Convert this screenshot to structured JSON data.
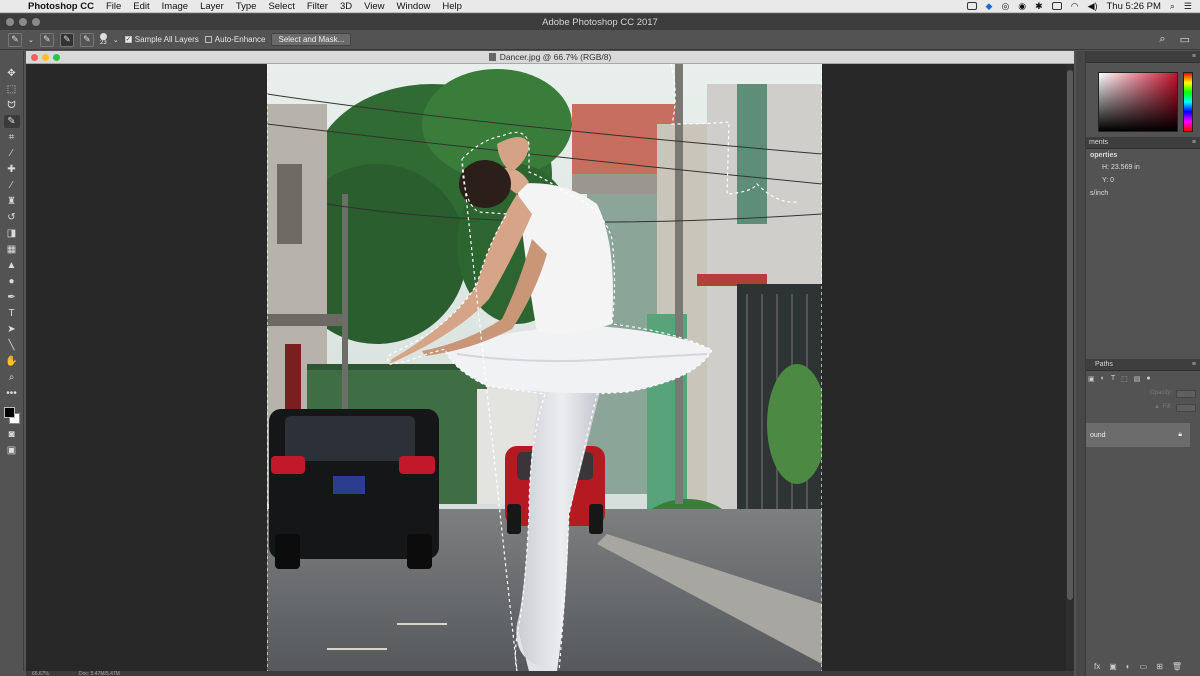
{
  "menubar": {
    "apple": "",
    "app": "Photoshop CC",
    "items": [
      "File",
      "Edit",
      "Image",
      "Layer",
      "Type",
      "Select",
      "Filter",
      "3D",
      "View",
      "Window",
      "Help"
    ],
    "clock": "Thu 5:26 PM"
  },
  "titlebar": {
    "title": "Adobe Photoshop CC 2017"
  },
  "options": {
    "brush_size": "23",
    "sample_all_layers": "Sample All Layers",
    "auto_enhance": "Auto-Enhance",
    "select_and_mask": "Select and Mask..."
  },
  "document": {
    "title": "Dancer.jpg @ 66.7% (RGB/8)"
  },
  "status": {
    "zoom": "66.67%",
    "doc": "Doc: 5.47M/5.47M"
  },
  "panels": {
    "adjustments": "ments",
    "properties": "operties",
    "h_value": "H: 23.569 in",
    "y_value": "Y: 0",
    "resolution": "s/inch",
    "paths": "Paths",
    "opacity": "Opacity:",
    "fill": "Fill:",
    "layer_name": "ound"
  },
  "colors": {
    "accent": "#c8102e",
    "canvas_bg": "#282828"
  }
}
